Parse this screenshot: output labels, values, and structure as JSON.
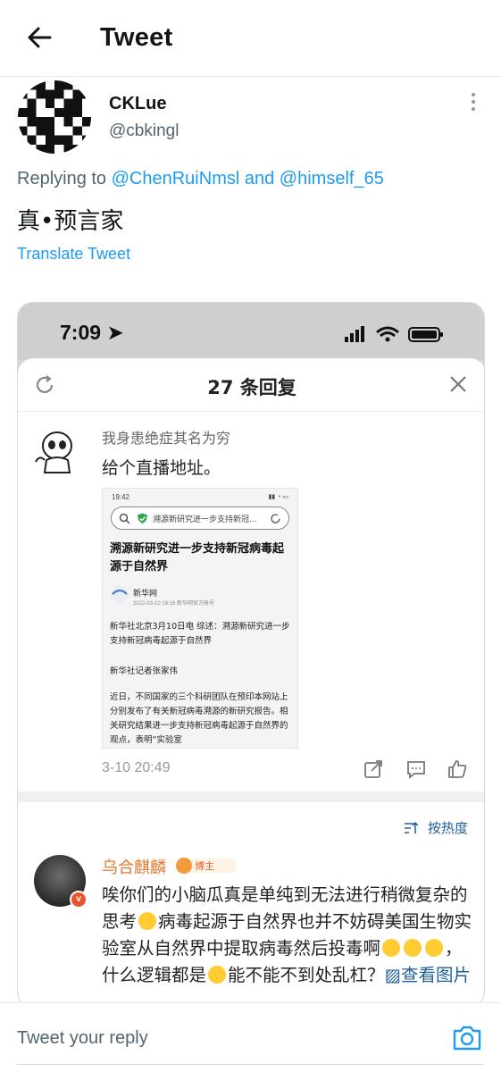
{
  "header": {
    "title": "Tweet"
  },
  "author": {
    "name": "CKLue",
    "handle": "@cbkingl"
  },
  "reply_context": {
    "prefix": "Replying to",
    "mention1": "@ChenRuiNmsl",
    "joiner": "and",
    "mention2": "@himself_65"
  },
  "tweet": {
    "text": "真•预言家",
    "translate": "Translate Tweet"
  },
  "media": {
    "time": "7:09",
    "sheet_title": "27 条回复",
    "comment1": {
      "name": "我身患绝症其名为穷",
      "text": "给个直播地址。",
      "time": "3-10 20:49",
      "inner": {
        "time": "19:42",
        "search": "溯源新研究进一步支持新冠...",
        "headline": "溯源新研究进一步支持新冠病毒起源于自然界",
        "source": "新华网",
        "date": "2022-03-10 18:16  新华网官方帐号",
        "p1": "新华社北京3月10日电 综述：溯源新研究进一步支持新冠病毒起源于自然界",
        "p2": "新华社记者张家伟",
        "p3": "近日，不同国家的三个科研团队在预印本网站上分别发布了有关新冠病毒溯源的新研究报告。相关研究结果进一步支持新冠病毒起源于自然界的观点，表明“实验室"
      }
    },
    "sort_label": "按热度",
    "comment2": {
      "name": "乌合麒麟",
      "tag": "博主",
      "line_a": "唉你们的小脑瓜真是单纯到无法进行稍微复杂的思考",
      "line_b": "病毒起源于自然界也并不妨碍美国生物实验室从自然界中提取病毒然后投毒啊",
      "line_c": "，什么逻辑都是",
      "line_d": "能不能不到处乱杠？",
      "link": "查看图片"
    }
  },
  "reply_bar": {
    "placeholder": "Tweet your reply"
  },
  "colors": {
    "accent": "#1d9bf0",
    "weibo_orange": "#e8772e",
    "weibo_link": "#1f5f9e"
  }
}
